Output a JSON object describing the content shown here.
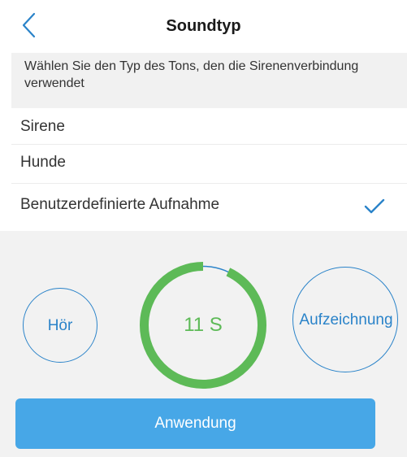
{
  "header": {
    "title": "Soundtyp",
    "back_icon": "chevron-left-icon"
  },
  "hint": {
    "text": "Wählen Sie den Typ des Tons, den die Sirenenverbindung verwendet"
  },
  "options": [
    {
      "label": "Sirene",
      "selected": false
    },
    {
      "label": "Hunde",
      "selected": false
    },
    {
      "label": "Benutzerdefinierte Aufnahme",
      "selected": true
    }
  ],
  "recorder": {
    "play_label": "Hör",
    "timer_text": "11 S",
    "timer_progress": 0.93,
    "record_label": "Aufzeichnung",
    "apply_label": "Anwendung"
  },
  "colors": {
    "accent_blue": "#2a83c9",
    "button_blue": "#47a7e7",
    "progress_green": "#5dba57"
  }
}
